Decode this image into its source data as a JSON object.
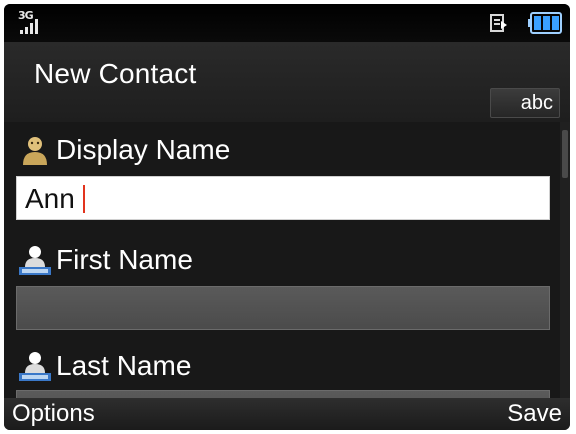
{
  "status_bar": {
    "network_tag": "3G",
    "signal_icon": "signal-bars-icon",
    "message_icon": "message-indicator-icon",
    "battery_icon": "battery-full-icon"
  },
  "header": {
    "title": "New Contact",
    "input_mode": "abc"
  },
  "fields": {
    "display_name": {
      "label": "Display Name",
      "value": "Ann",
      "icon": "person-icon"
    },
    "first_name": {
      "label": "First Name",
      "value": "",
      "icon": "person-card-icon"
    },
    "last_name": {
      "label": "Last Name",
      "value": "",
      "icon": "person-card-icon"
    }
  },
  "softkeys": {
    "left": "Options",
    "right": "Save"
  },
  "colors": {
    "background": "#1a1a1a",
    "caret": "#e2341e",
    "battery": "#3aa0ff"
  }
}
